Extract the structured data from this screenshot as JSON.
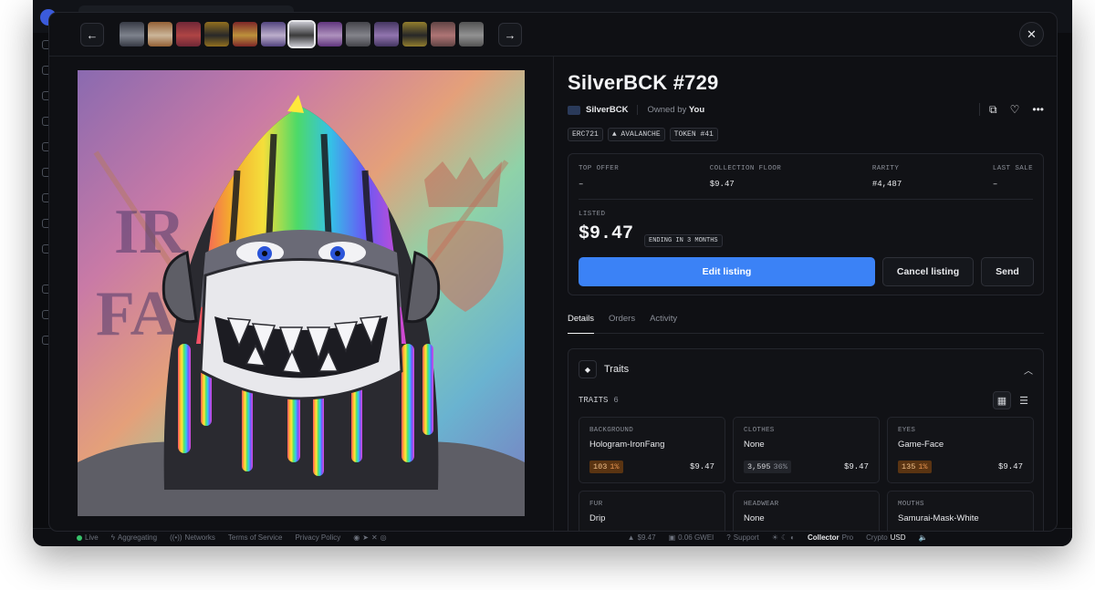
{
  "nft": {
    "title": "SilverBCK #729",
    "collection": "SilverBCK",
    "owned_prefix": "Owned by",
    "owner": "You",
    "badges": [
      "ERC721",
      "AVALANCHE",
      "TOKEN #41"
    ]
  },
  "stats": [
    {
      "label": "TOP OFFER",
      "value": "–"
    },
    {
      "label": "COLLECTION FLOOR",
      "value": "$9.47"
    },
    {
      "label": "RARITY",
      "value": "#4,487"
    },
    {
      "label": "LAST SALE",
      "value": "–"
    }
  ],
  "listing": {
    "label": "LISTED",
    "price": "$9.47",
    "ending": "ENDING IN 3 MONTHS",
    "edit_label": "Edit listing",
    "cancel_label": "Cancel listing",
    "send_label": "Send"
  },
  "tabs": [
    "Details",
    "Orders",
    "Activity"
  ],
  "traits_section": {
    "title": "Traits",
    "count_label": "TRAITS",
    "count": "6"
  },
  "traits": [
    {
      "key": "BACKGROUND",
      "value": "Hologram-IronFang",
      "count": "103",
      "pct": "1%",
      "rare": true,
      "price": "$9.47"
    },
    {
      "key": "CLOTHES",
      "value": "None",
      "count": "3,595",
      "pct": "36%",
      "rare": false,
      "price": "$9.47"
    },
    {
      "key": "EYES",
      "value": "Game-Face",
      "count": "135",
      "pct": "1%",
      "rare": true,
      "price": "$9.47"
    },
    {
      "key": "FUR",
      "value": "Drip",
      "count": "",
      "pct": "",
      "rare": false,
      "price": ""
    },
    {
      "key": "HEADWEAR",
      "value": "None",
      "count": "",
      "pct": "",
      "rare": false,
      "price": ""
    },
    {
      "key": "MOUTHS",
      "value": "Samurai-Mask-White",
      "count": "",
      "pct": "",
      "rare": false,
      "price": ""
    }
  ],
  "thumbnails": [
    {
      "color": "#3b3f4a",
      "accent": "#8a8f9a"
    },
    {
      "color": "#a36a3a",
      "accent": "#e0c8a8"
    },
    {
      "color": "#7a2a3a",
      "accent": "#c04a4a"
    },
    {
      "color": "#a07a20",
      "accent": "#2b2b2b"
    },
    {
      "color": "#8a2a2a",
      "accent": "#d0a040"
    },
    {
      "color": "#5a4a8a",
      "accent": "#d0c0e0"
    },
    {
      "color": "#c8c8d0",
      "accent": "#3a3a3a"
    },
    {
      "color": "#6a3a8a",
      "accent": "#c0a0d0"
    },
    {
      "color": "#4a4a50",
      "accent": "#909098"
    },
    {
      "color": "#4a3a6a",
      "accent": "#a080c0"
    },
    {
      "color": "#a08a30",
      "accent": "#2a2a2a"
    },
    {
      "color": "#6a4a4a",
      "accent": "#c08080"
    },
    {
      "color": "#5a5a5a",
      "accent": "#a0a0a0"
    }
  ],
  "status_bar": {
    "live": "Live",
    "aggregating": "Aggregating",
    "networks": "Networks",
    "terms": "Terms of Service",
    "privacy": "Privacy Policy",
    "avax_price": "$9.47",
    "gas": "0.06 GWEI",
    "support": "Support",
    "mode": "Collector",
    "pro": "Pro",
    "crypto": "Crypto",
    "currency": "USD"
  },
  "colors": {
    "accent": "#3b82f6",
    "rare_badge": "#5a3412",
    "live_dot": "#37c26a"
  }
}
